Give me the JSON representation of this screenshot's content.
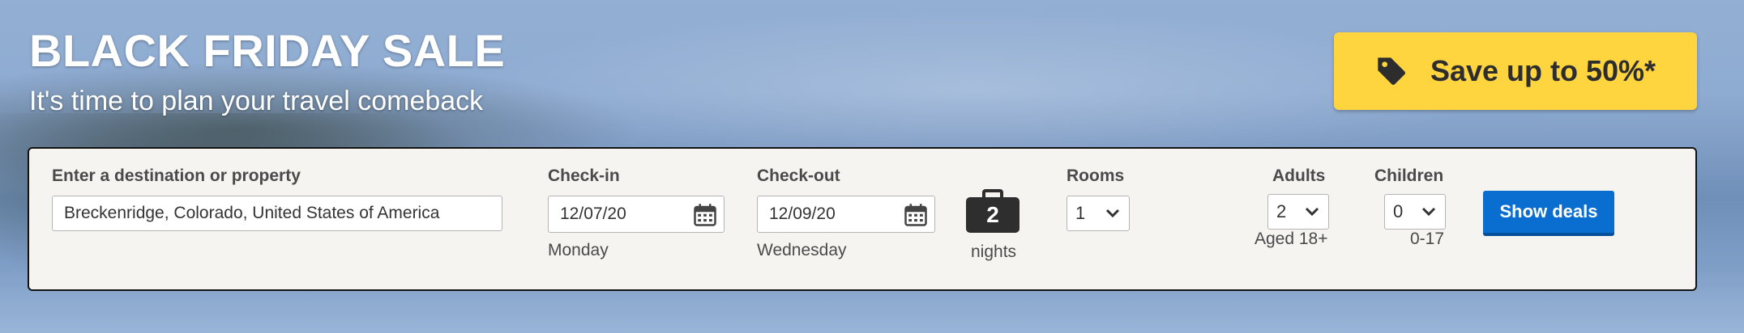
{
  "banner": {
    "headline": "BLACK FRIDAY SALE",
    "subline": "It's time to plan your travel comeback",
    "promo_label": "Save up to 50%*",
    "promo_icon": "tag-icon"
  },
  "search": {
    "destination_label": "Enter a destination or property",
    "destination_value": "Breckenridge, Colorado, United States of America",
    "checkin_label": "Check-in",
    "checkin_value": "12/07/20",
    "checkin_day": "Monday",
    "checkout_label": "Check-out",
    "checkout_value": "12/09/20",
    "checkout_day": "Wednesday",
    "nights_count": "2",
    "nights_label": "nights",
    "rooms_label": "Rooms",
    "rooms_value": "1",
    "adults_label": "Adults",
    "adults_value": "2",
    "adults_note": "Aged 18+",
    "children_label": "Children",
    "children_value": "0",
    "children_note": "0-17",
    "submit_label": "Show deals",
    "calendar_icon": "calendar-icon",
    "suitcase_icon": "suitcase-icon"
  },
  "colors": {
    "promo_bg": "#fed43f",
    "button_bg": "#0a6ed1",
    "panel_bg": "#f5f4f1"
  }
}
